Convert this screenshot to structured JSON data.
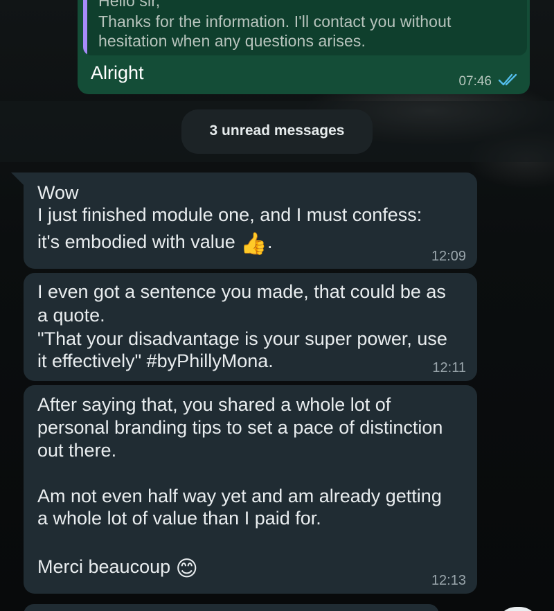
{
  "outgoing": {
    "quote_lines": [
      "Hello sir,",
      "Thanks for the information. I'll contact you without",
      "hesitation when any questions arises."
    ],
    "text": "Alright",
    "time": "07:46"
  },
  "unread_label": "3 unread messages",
  "messages": [
    {
      "lines": [
        "Wow",
        "I just finished module one, and I must confess:",
        "it's embodied with value"
      ],
      "emoji": "👍",
      "trail": ".",
      "time": "12:09"
    },
    {
      "lines": [
        "I even got a sentence you made, that could be as",
        "a quote.",
        "\"That your disadvantage is your super power, use",
        "it effectively\" #byPhillyMona."
      ],
      "time": "12:11"
    },
    {
      "lines": [
        "After saying that, you shared a whole lot of",
        "personal branding tips to set a pace of distinction",
        "out there.",
        "Am not even half way yet and am already getting",
        "a whole lot of value than I paid for.",
        "Merci beaucoup"
      ],
      "emoji": "😊",
      "time": "12:13"
    }
  ],
  "colors": {
    "outgoing_bubble": "#144d37",
    "incoming_bubble": "#202c33",
    "quote_bar": "#a78bfa",
    "read_ticks": "#53bdeb"
  },
  "icons": [
    "double-check-icon"
  ]
}
